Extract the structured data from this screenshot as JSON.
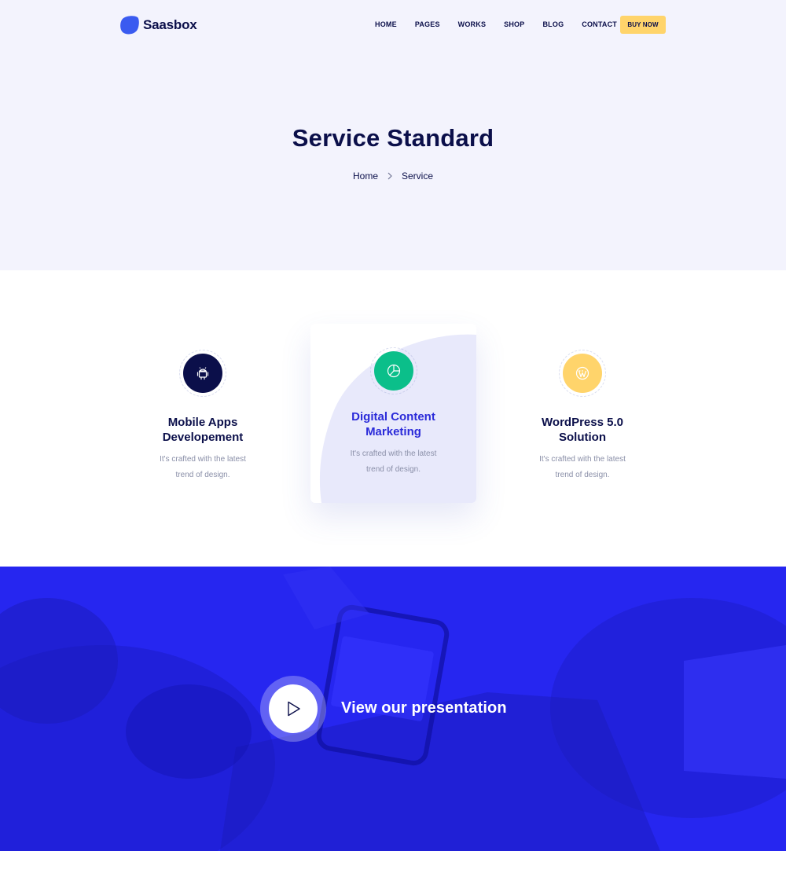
{
  "header": {
    "logo_text": "Saasbox",
    "logo_icon": "blob-logo-icon",
    "nav": [
      "HOME",
      "PAGES",
      "WORKS",
      "SHOP",
      "BLOG",
      "CONTACT"
    ],
    "buy_label": "BUY NOW"
  },
  "hero": {
    "title": "Service Standard",
    "breadcrumb": {
      "home": "Home",
      "separator_icon": "chevron-right-icon",
      "current": "Service"
    }
  },
  "services": [
    {
      "icon": "android-icon",
      "title_line1": "Mobile Apps",
      "title_line2": "Developement",
      "desc_line1": "It's crafted with the latest",
      "desc_line2": "trend of design."
    },
    {
      "icon": "pie-chart-icon",
      "title_line1": "Digital Content",
      "title_line2": "Marketing",
      "desc_line1": "It's crafted with the latest",
      "desc_line2": "trend of design."
    },
    {
      "icon": "wordpress-icon",
      "title_line1": "WordPress 5.0",
      "title_line2": "Solution",
      "desc_line1": "It's crafted with the latest",
      "desc_line2": "trend of design."
    }
  ],
  "banner": {
    "cta_text": "View our presentation",
    "play_icon": "play-icon"
  },
  "colors": {
    "navy": "#0b0f4a",
    "primary_blue": "#2626f0",
    "accent_yellow": "#ffd46b",
    "accent_green": "#0bbf8a",
    "hero_bg": "#f3f3fd"
  }
}
